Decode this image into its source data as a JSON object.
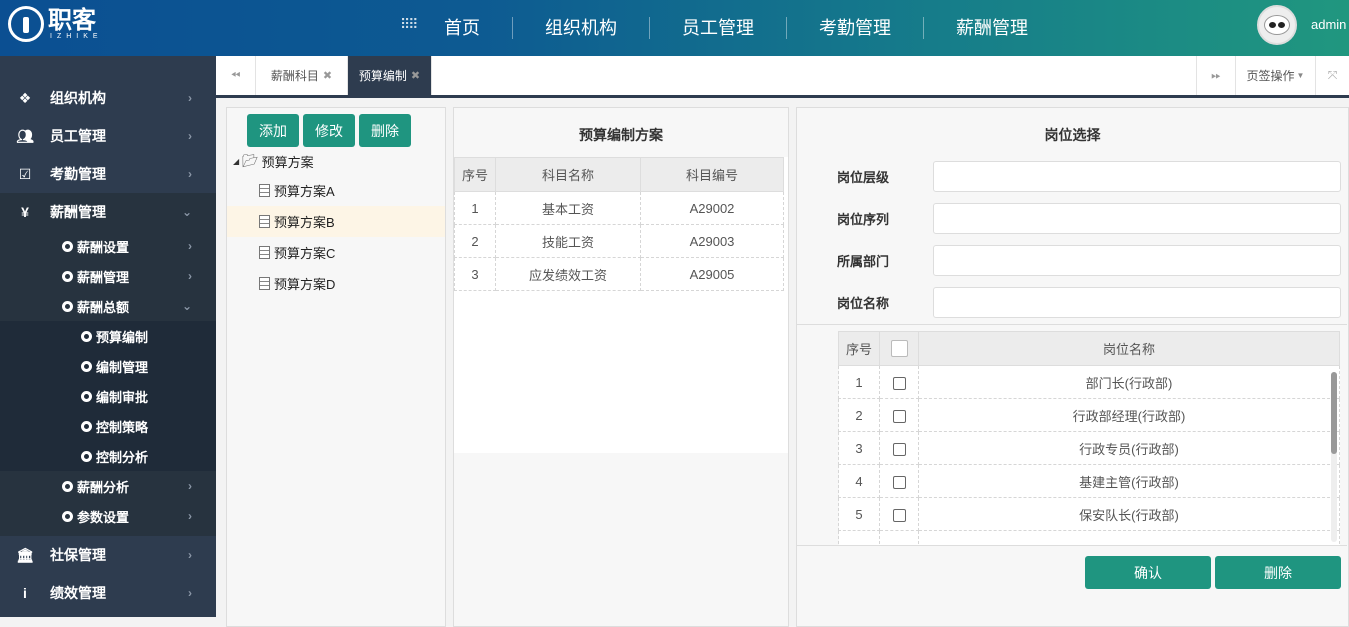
{
  "header": {
    "logo": "职客",
    "logo_sub": "IZHIKE",
    "nav": [
      "首页",
      "组织机构",
      "员工管理",
      "考勤管理",
      "薪酬管理"
    ],
    "user": "admin"
  },
  "sidebar": {
    "top_items": [
      {
        "label": "组织机构",
        "icon": "sitemap-icon"
      },
      {
        "label": "员工管理",
        "icon": "users-icon"
      },
      {
        "label": "考勤管理",
        "icon": "check-square-icon"
      },
      {
        "label": "薪酬管理",
        "icon": "yen-icon"
      }
    ],
    "salary_sub": [
      "薪酬设置",
      "薪酬管理",
      "薪酬总额"
    ],
    "total_sub": [
      "预算编制",
      "编制管理",
      "编制审批",
      "控制策略",
      "控制分析"
    ],
    "salary_sub2": [
      "薪酬分析",
      "参数设置"
    ],
    "bottom_items": [
      {
        "label": "社保管理",
        "icon": "bank-icon"
      },
      {
        "label": "绩效管理",
        "icon": "info-icon"
      }
    ]
  },
  "tabs": {
    "items": [
      {
        "label": "薪酬科目"
      },
      {
        "label": "预算编制"
      }
    ],
    "ops": "页签操作"
  },
  "tree": {
    "buttons": [
      "添加",
      "修改",
      "删除"
    ],
    "root": "预算方案",
    "children": [
      "预算方案A",
      "预算方案B",
      "预算方案C",
      "预算方案D"
    ],
    "selected": 1
  },
  "budget": {
    "title": "预算编制方案",
    "columns": [
      "序号",
      "科目名称",
      "科目编号"
    ],
    "rows": [
      [
        "1",
        "基本工资",
        "A29002"
      ],
      [
        "2",
        "技能工资",
        "A29003"
      ],
      [
        "3",
        "应发绩效工资",
        "A29005"
      ]
    ]
  },
  "position": {
    "title": "岗位选择",
    "fields": [
      {
        "label": "岗位层级",
        "value": ""
      },
      {
        "label": "岗位序列",
        "value": ""
      },
      {
        "label": "所属部门",
        "value": ""
      },
      {
        "label": "岗位名称",
        "value": ""
      }
    ],
    "columns": [
      "序号",
      "岗位名称"
    ],
    "rows": [
      [
        "1",
        "部门长(行政部)"
      ],
      [
        "2",
        "行政部经理(行政部)"
      ],
      [
        "3",
        "行政专员(行政部)"
      ],
      [
        "4",
        "基建主管(行政部)"
      ],
      [
        "5",
        "保安队长(行政部)"
      ]
    ],
    "confirm": "确认",
    "delete": "删除"
  }
}
